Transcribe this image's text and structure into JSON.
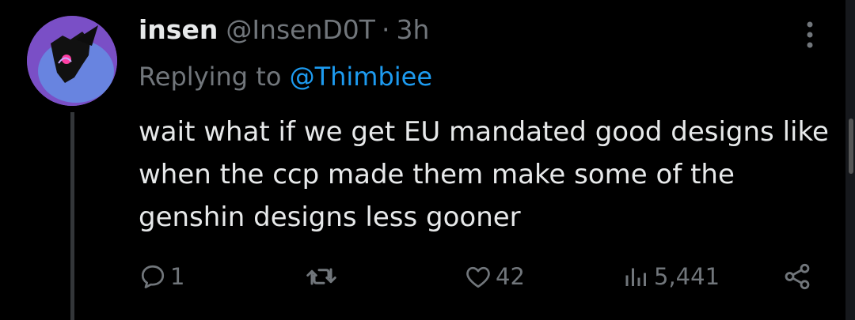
{
  "tweet": {
    "display_name": "insen",
    "handle": "@InsenD0T",
    "separator": "·",
    "time": "3h",
    "replying_prefix": "Replying to ",
    "replying_to": "@Thimbiee",
    "text": "wait what if we get EU mandated good designs like when the ccp made them make some of the genshin designs less gooner"
  },
  "actions": {
    "replies": "1",
    "retweets": "",
    "likes": "42",
    "views": "5,441"
  },
  "colors": {
    "background": "#000000",
    "text": "#e7e9ea",
    "muted": "#71767b",
    "accent": "#1d9bf0",
    "thread_line": "#333639"
  },
  "icons": {
    "more": "more-vertical-icon",
    "reply": "reply-icon",
    "retweet": "retweet-icon",
    "like": "heart-icon",
    "views": "views-icon",
    "share": "share-icon"
  }
}
